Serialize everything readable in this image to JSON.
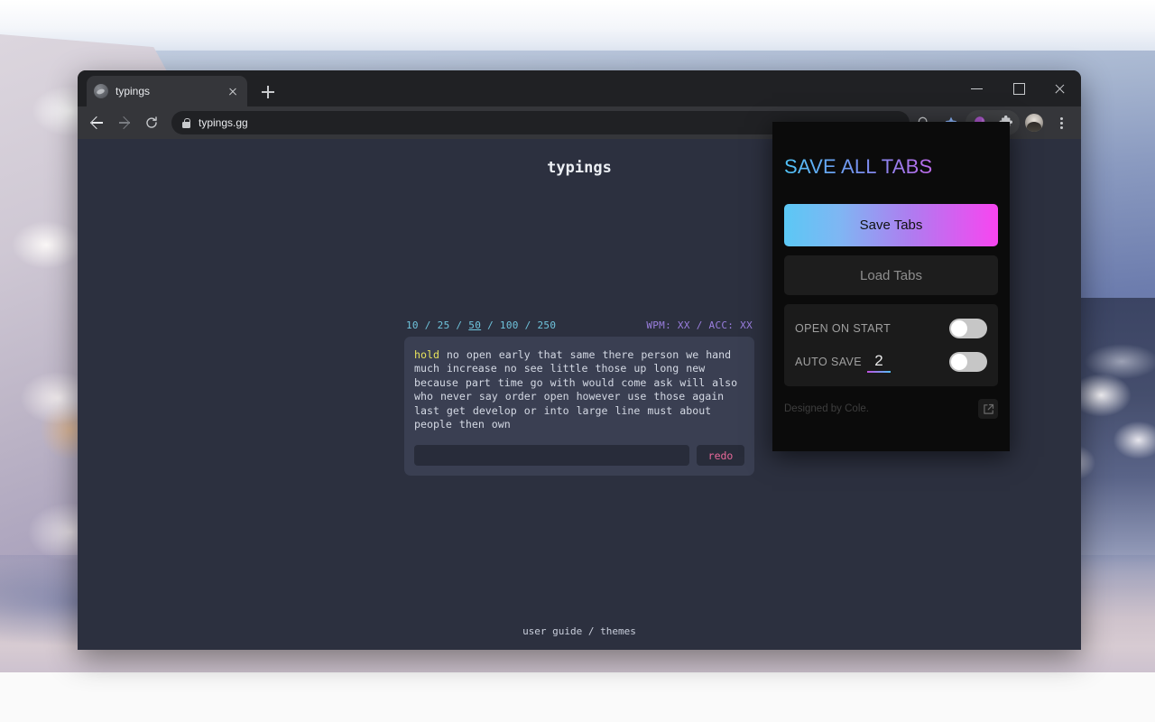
{
  "browser": {
    "tab": {
      "title": "typings",
      "favicon": "globe-icon",
      "close": "close-icon"
    },
    "new_tab": "+",
    "window_controls": {
      "minimize": "minimize-icon",
      "maximize": "maximize-icon",
      "close": "close-icon"
    },
    "nav": {
      "back": "back-arrow-icon",
      "forward": "forward-arrow-icon",
      "reload": "reload-icon"
    },
    "omnibox": {
      "url": "typings.gg",
      "security": "lock-icon"
    },
    "toolbar_icons": [
      "search-icon",
      "bookmark-star-icon",
      "save-all-tabs-extension-icon",
      "extensions-puzzle-icon",
      "profile-avatar",
      "three-dot-menu-icon"
    ]
  },
  "page": {
    "title": "typings",
    "word_counts": {
      "options": [
        "10",
        "25",
        "50",
        "100",
        "250"
      ],
      "active": "50",
      "separator": "/"
    },
    "stats": {
      "wpm_label": "WPM",
      "wpm_value": "XX",
      "separator": "/",
      "acc_label": "ACC",
      "acc_value": "XX",
      "text": "WPM: XX / ACC: XX"
    },
    "words": [
      "hold",
      "no",
      "open",
      "early",
      "that",
      "same",
      "there",
      "person",
      "we",
      "hand",
      "much",
      "increase",
      "no",
      "see",
      "little",
      "those",
      "up",
      "long",
      "new",
      "because",
      "part",
      "time",
      "go",
      "with",
      "would",
      "come",
      "ask",
      "will",
      "also",
      "who",
      "never",
      "say",
      "order",
      "open",
      "however",
      "use",
      "those",
      "again",
      "last",
      "get",
      "develop",
      "or",
      "into",
      "large",
      "line",
      "must",
      "about",
      "people",
      "then",
      "own"
    ],
    "current_word_index": 0,
    "input": {
      "value": "",
      "placeholder": ""
    },
    "redo_label": "redo",
    "footer": {
      "user_guide": "user guide",
      "separator": "/",
      "themes": "themes"
    }
  },
  "popup": {
    "title": "SAVE ALL TABS",
    "save_button": "Save Tabs",
    "load_button": "Load Tabs",
    "settings": [
      {
        "label": "OPEN ON START",
        "toggle_state": "off"
      },
      {
        "label": "AUTO SAVE",
        "value": "2",
        "toggle_state": "off"
      }
    ],
    "credit": "Designed by Cole.",
    "external_link": "external-link-icon"
  },
  "colors": {
    "accent_cyan": "#5bc8f5",
    "accent_magenta": "#f845f0",
    "page_bg": "#2c303f",
    "card_bg": "#3a3f52",
    "wordcount_blue": "#6fc4dd",
    "stats_purple": "#9b7fe0",
    "current_word_yellow": "#e8e35c",
    "redo_pink": "#e8699a",
    "popup_bg": "#0b0b0b"
  }
}
